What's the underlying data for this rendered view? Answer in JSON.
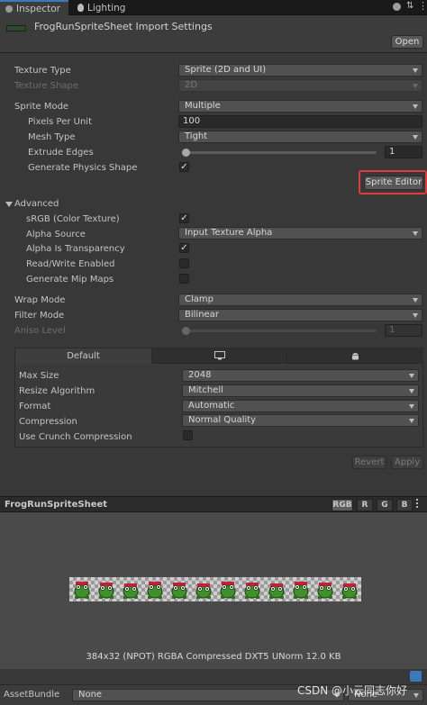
{
  "tabs": [
    {
      "label": "Inspector"
    },
    {
      "label": "Lighting"
    }
  ],
  "header": {
    "title": "FrogRunSpriteSheet Import Settings",
    "open_label": "Open"
  },
  "settings": {
    "texture_type": {
      "label": "Texture Type",
      "value": "Sprite (2D and UI)"
    },
    "texture_shape": {
      "label": "Texture Shape",
      "value": "2D"
    },
    "sprite_mode": {
      "label": "Sprite Mode",
      "value": "Multiple"
    },
    "pixels_per_unit": {
      "label": "Pixels Per Unit",
      "value": "100"
    },
    "mesh_type": {
      "label": "Mesh Type",
      "value": "Tight"
    },
    "extrude_edges": {
      "label": "Extrude Edges",
      "value": "1",
      "fraction": 0.0
    },
    "generate_physics_shape": {
      "label": "Generate Physics Shape",
      "checked": true
    },
    "sprite_editor_label": "Sprite Editor",
    "advanced_label": "Advanced",
    "srgb": {
      "label": "sRGB (Color Texture)",
      "checked": true
    },
    "alpha_source": {
      "label": "Alpha Source",
      "value": "Input Texture Alpha"
    },
    "alpha_is_transparency": {
      "label": "Alpha Is Transparency",
      "checked": true
    },
    "read_write": {
      "label": "Read/Write Enabled",
      "checked": false
    },
    "mip_maps": {
      "label": "Generate Mip Maps",
      "checked": false
    },
    "wrap_mode": {
      "label": "Wrap Mode",
      "value": "Clamp"
    },
    "filter_mode": {
      "label": "Filter Mode",
      "value": "Bilinear"
    },
    "aniso_level": {
      "label": "Aniso Level",
      "value": "1",
      "fraction": 0.0
    }
  },
  "platform": {
    "tabs": [
      {
        "label": "Default",
        "icon": "default"
      },
      {
        "label": "",
        "icon": "monitor-icon"
      },
      {
        "label": "",
        "icon": "android-icon"
      }
    ],
    "max_size": {
      "label": "Max Size",
      "value": "2048"
    },
    "resize_algorithm": {
      "label": "Resize Algorithm",
      "value": "Mitchell"
    },
    "format": {
      "label": "Format",
      "value": "Automatic"
    },
    "compression": {
      "label": "Compression",
      "value": "Normal Quality"
    },
    "crunch": {
      "label": "Use Crunch Compression",
      "checked": false
    }
  },
  "actions": {
    "revert": "Revert",
    "apply": "Apply"
  },
  "preview": {
    "name": "FrogRunSpriteSheet",
    "channels": [
      "RGB",
      "R",
      "G",
      "B"
    ],
    "frame_count": 12,
    "info": "384x32 (NPOT)  RGBA Compressed DXT5 UNorm  12.0 KB"
  },
  "asset_bundle": {
    "label": "AssetBundle",
    "value": "None",
    "variant": "None"
  },
  "watermark": "CSDN @小云同志你好",
  "colors": {
    "accent": "#3a79bb",
    "highlight_box": "#e03a3a",
    "background": "#383838"
  }
}
